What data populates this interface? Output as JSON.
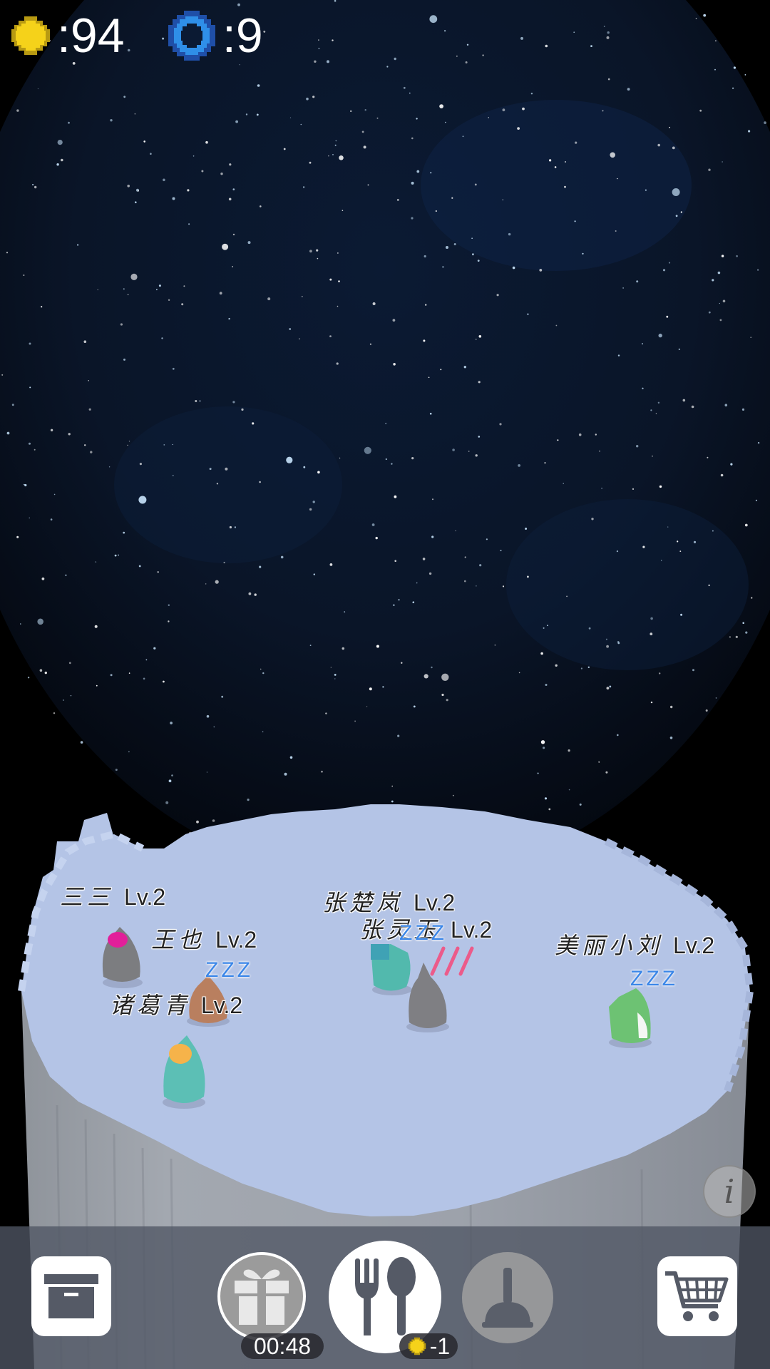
{
  "hud": {
    "coin_icon": "sun-coin-icon",
    "coin_text": ":94",
    "gem_icon": "blue-gem-icon",
    "gem_text": ":9"
  },
  "creatures": [
    {
      "name": "三三",
      "level": "Lv.2",
      "sleeping": false
    },
    {
      "name": "王也",
      "level": "Lv.2",
      "sleeping": true
    },
    {
      "name": "诸葛青",
      "level": "Lv.2",
      "sleeping": false
    },
    {
      "name": "张楚岚",
      "level": "Lv.2",
      "sleeping": false
    },
    {
      "name": "张灵玉",
      "level": "Lv.2",
      "sleeping": true
    },
    {
      "name": "美丽小刘",
      "level": "Lv.2",
      "sleeping": true
    }
  ],
  "sleep_text": "ZZZ",
  "info": {
    "icon": "info-icon",
    "label": "i"
  },
  "bottom_bar": {
    "archive_icon": "archive-box-icon",
    "gift_icon": "gift-box-icon",
    "gift_timer": "00:48",
    "feed_icon": "fork-spoon-icon",
    "feed_cost": "-1",
    "clean_icon": "plunger-icon",
    "cart_icon": "shopping-cart-icon"
  },
  "colors": {
    "coin": "#f5d21a",
    "gem": "#2f8fe8",
    "island_top": "#b4c4e6",
    "island_side": "#8f949e",
    "sleep": "#3a86e8"
  }
}
